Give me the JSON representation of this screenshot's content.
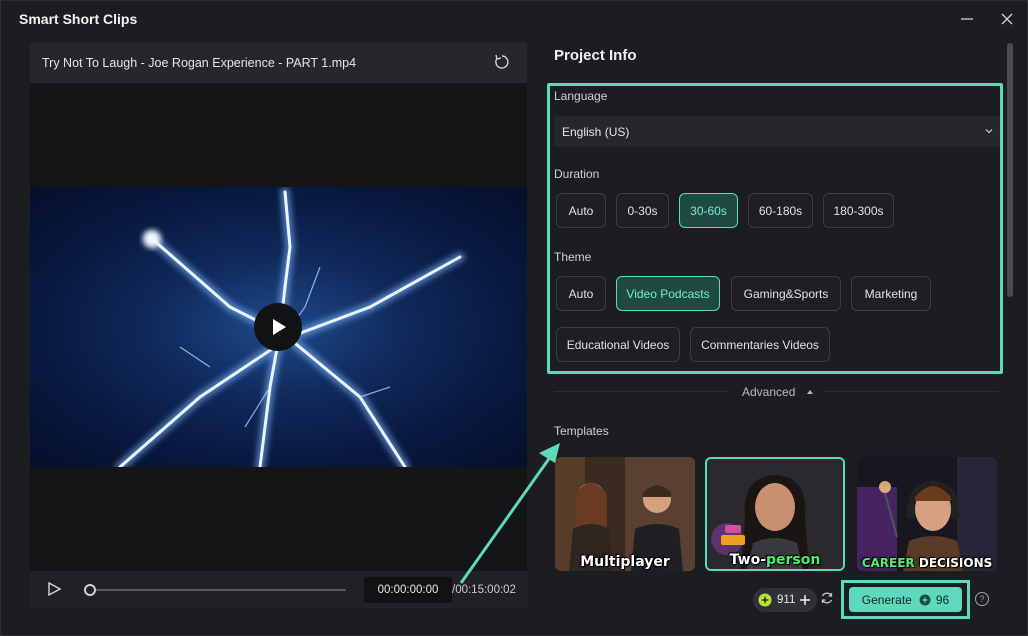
{
  "window": {
    "title": "Smart Short Clips"
  },
  "player": {
    "file_name": "Try Not To Laugh - Joe Rogan Experience - PART 1.mp4",
    "current_time": "00:00:00:00",
    "total_time": "/00:15:00:02"
  },
  "panel": {
    "title": "Project Info",
    "language": {
      "label": "Language",
      "value": "English (US)"
    },
    "duration": {
      "label": "Duration",
      "options": [
        "Auto",
        "0-30s",
        "30-60s",
        "60-180s",
        "180-300s"
      ],
      "selected": "30-60s"
    },
    "theme": {
      "label": "Theme",
      "options": [
        "Auto",
        "Video Podcasts",
        "Gaming&Sports",
        "Marketing",
        "Educational Videos",
        "Commentaries Videos"
      ],
      "selected": "Video Podcasts"
    },
    "advanced_label": "Advanced",
    "templates": {
      "label": "Templates",
      "items": [
        {
          "caption": "Multiplayer"
        },
        {
          "caption_a": "Two-",
          "caption_b": "person"
        },
        {
          "caption_a": "CAREER",
          "caption_b": "DECISIONS"
        }
      ]
    }
  },
  "footer": {
    "credits": "911",
    "generate_label": "Generate",
    "generate_cost": "96",
    "help": "?"
  },
  "colors": {
    "accent": "#5ed9bd",
    "bg": "#1c1d20"
  }
}
